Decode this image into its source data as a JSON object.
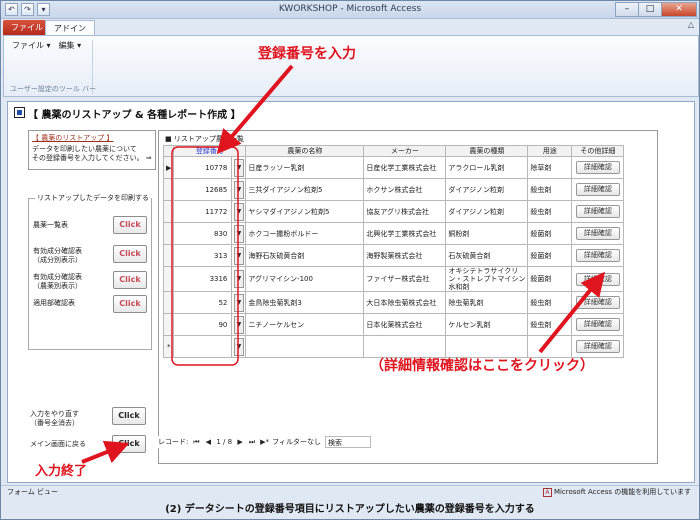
{
  "window": {
    "title": "KWORKSHOP - Microsoft Access"
  },
  "qat": [
    "↶",
    "↷",
    "▾"
  ],
  "window_controls": {
    "minimize": "–",
    "maximize": "□",
    "close": "✕"
  },
  "ribbon": {
    "tabs": [
      "ファイル",
      "アドイン"
    ],
    "menus": [
      "ファイル ▾",
      "編集 ▾"
    ],
    "group_label": "ユーザー設定のツール バー",
    "minimize_glyph": "△"
  },
  "form": {
    "title": "【 農薬のリストアップ & 各種レポート作成 】"
  },
  "left": {
    "list_title": "【 農薬のリストアップ 】",
    "instructions": [
      "データを印刷したい農薬について",
      "その登録番号を入力してください。 ⇒"
    ],
    "print_group_title": "リストアップしたデータを印刷する",
    "print_rows": [
      {
        "label": [
          "農薬一覧表"
        ],
        "button": "Click"
      },
      {
        "label": [
          "有効成分確認表",
          "（成分別表示）"
        ],
        "button": "Click"
      },
      {
        "label": [
          "有効成分確認表",
          "（農薬別表示）"
        ],
        "button": "Click"
      },
      {
        "label": [
          "適用部確認表"
        ],
        "button": "Click"
      }
    ],
    "redo": {
      "label": [
        "入力をやり直す",
        "（番号全消去）"
      ],
      "button": "Click"
    },
    "menu_return": {
      "label": "メイン画面に戻る",
      "button": "Click"
    }
  },
  "pane": {
    "title": "■ リストアップ農薬一覧",
    "headers": [
      "登録番号",
      "農薬の名称",
      "メーカー",
      "農薬の種類",
      "用途",
      "その他詳細"
    ],
    "rows": [
      {
        "selector": "▶",
        "reg": "10778",
        "name": "日産ラッソー乳剤",
        "maker": "日産化学工業株式会社",
        "kind": "アラクロール乳剤",
        "use": "除草剤",
        "btn": "詳細確認"
      },
      {
        "selector": "",
        "reg": "12685",
        "name": "三共ダイアジノン粒剤5",
        "maker": "ホクサン株式会社",
        "kind": "ダイアジノン粒剤",
        "use": "殺虫剤",
        "btn": "詳細確認"
      },
      {
        "selector": "",
        "reg": "11772",
        "name": "ヤシマダイアジノン粒剤5",
        "maker": "協友アグリ株式会社",
        "kind": "ダイアジノン粒剤",
        "use": "殺虫剤",
        "btn": "詳細確認"
      },
      {
        "selector": "",
        "reg": "830",
        "name": "ホクコー撒粉ボルドー",
        "maker": "北興化学工業株式会社",
        "kind": "銅粉剤",
        "use": "殺菌剤",
        "btn": "詳細確認"
      },
      {
        "selector": "",
        "reg": "313",
        "name": "海野石灰硫黄合剤",
        "maker": "海野製薬株式会社",
        "kind": "石灰硫黄合剤",
        "use": "殺菌剤",
        "btn": "詳細確認"
      },
      {
        "selector": "",
        "reg": "3316",
        "name": "アグリマイシン-100",
        "maker": "ファイザー株式会社",
        "kind": "オキシテトラサイクリン・ストレプトマイシン水和剤",
        "use": "殺菌剤",
        "btn": "詳細確認"
      },
      {
        "selector": "",
        "reg": "52",
        "name": "金鳥除虫菊乳剤3",
        "maker": "大日本除虫菊株式会社",
        "kind": "除虫菊乳剤",
        "use": "殺虫剤",
        "btn": "詳細確認"
      },
      {
        "selector": "",
        "reg": "90",
        "name": "ニチノーケルセン",
        "maker": "日本化薬株式会社",
        "kind": "ケルセン乳剤",
        "use": "殺虫剤",
        "btn": "詳細確認"
      }
    ],
    "new_row": {
      "selector": "*",
      "btn": "詳細確認"
    }
  },
  "recnav": {
    "label": "レコード:",
    "first": "⏮",
    "prev": "◀",
    "position": "1 / 8",
    "next": "▶",
    "last": "⏭",
    "new": "▶*",
    "filter": "フィルターなし",
    "search": "検索"
  },
  "status": {
    "left": "フォーム ビュー",
    "right": "Microsoft Access の機能を利用しています"
  },
  "annotations": {
    "enter": "登録番号を入力",
    "detail": "（詳細情報確認はここをクリック）",
    "done": "入力終了"
  },
  "caption": "(2) データシートの登録番号項目にリストアップしたい農薬の登録番号を入力する",
  "colors": {
    "annotation": "#e0141f",
    "file_tab": "#c33a27",
    "header_reg": "#2c3ad0"
  }
}
